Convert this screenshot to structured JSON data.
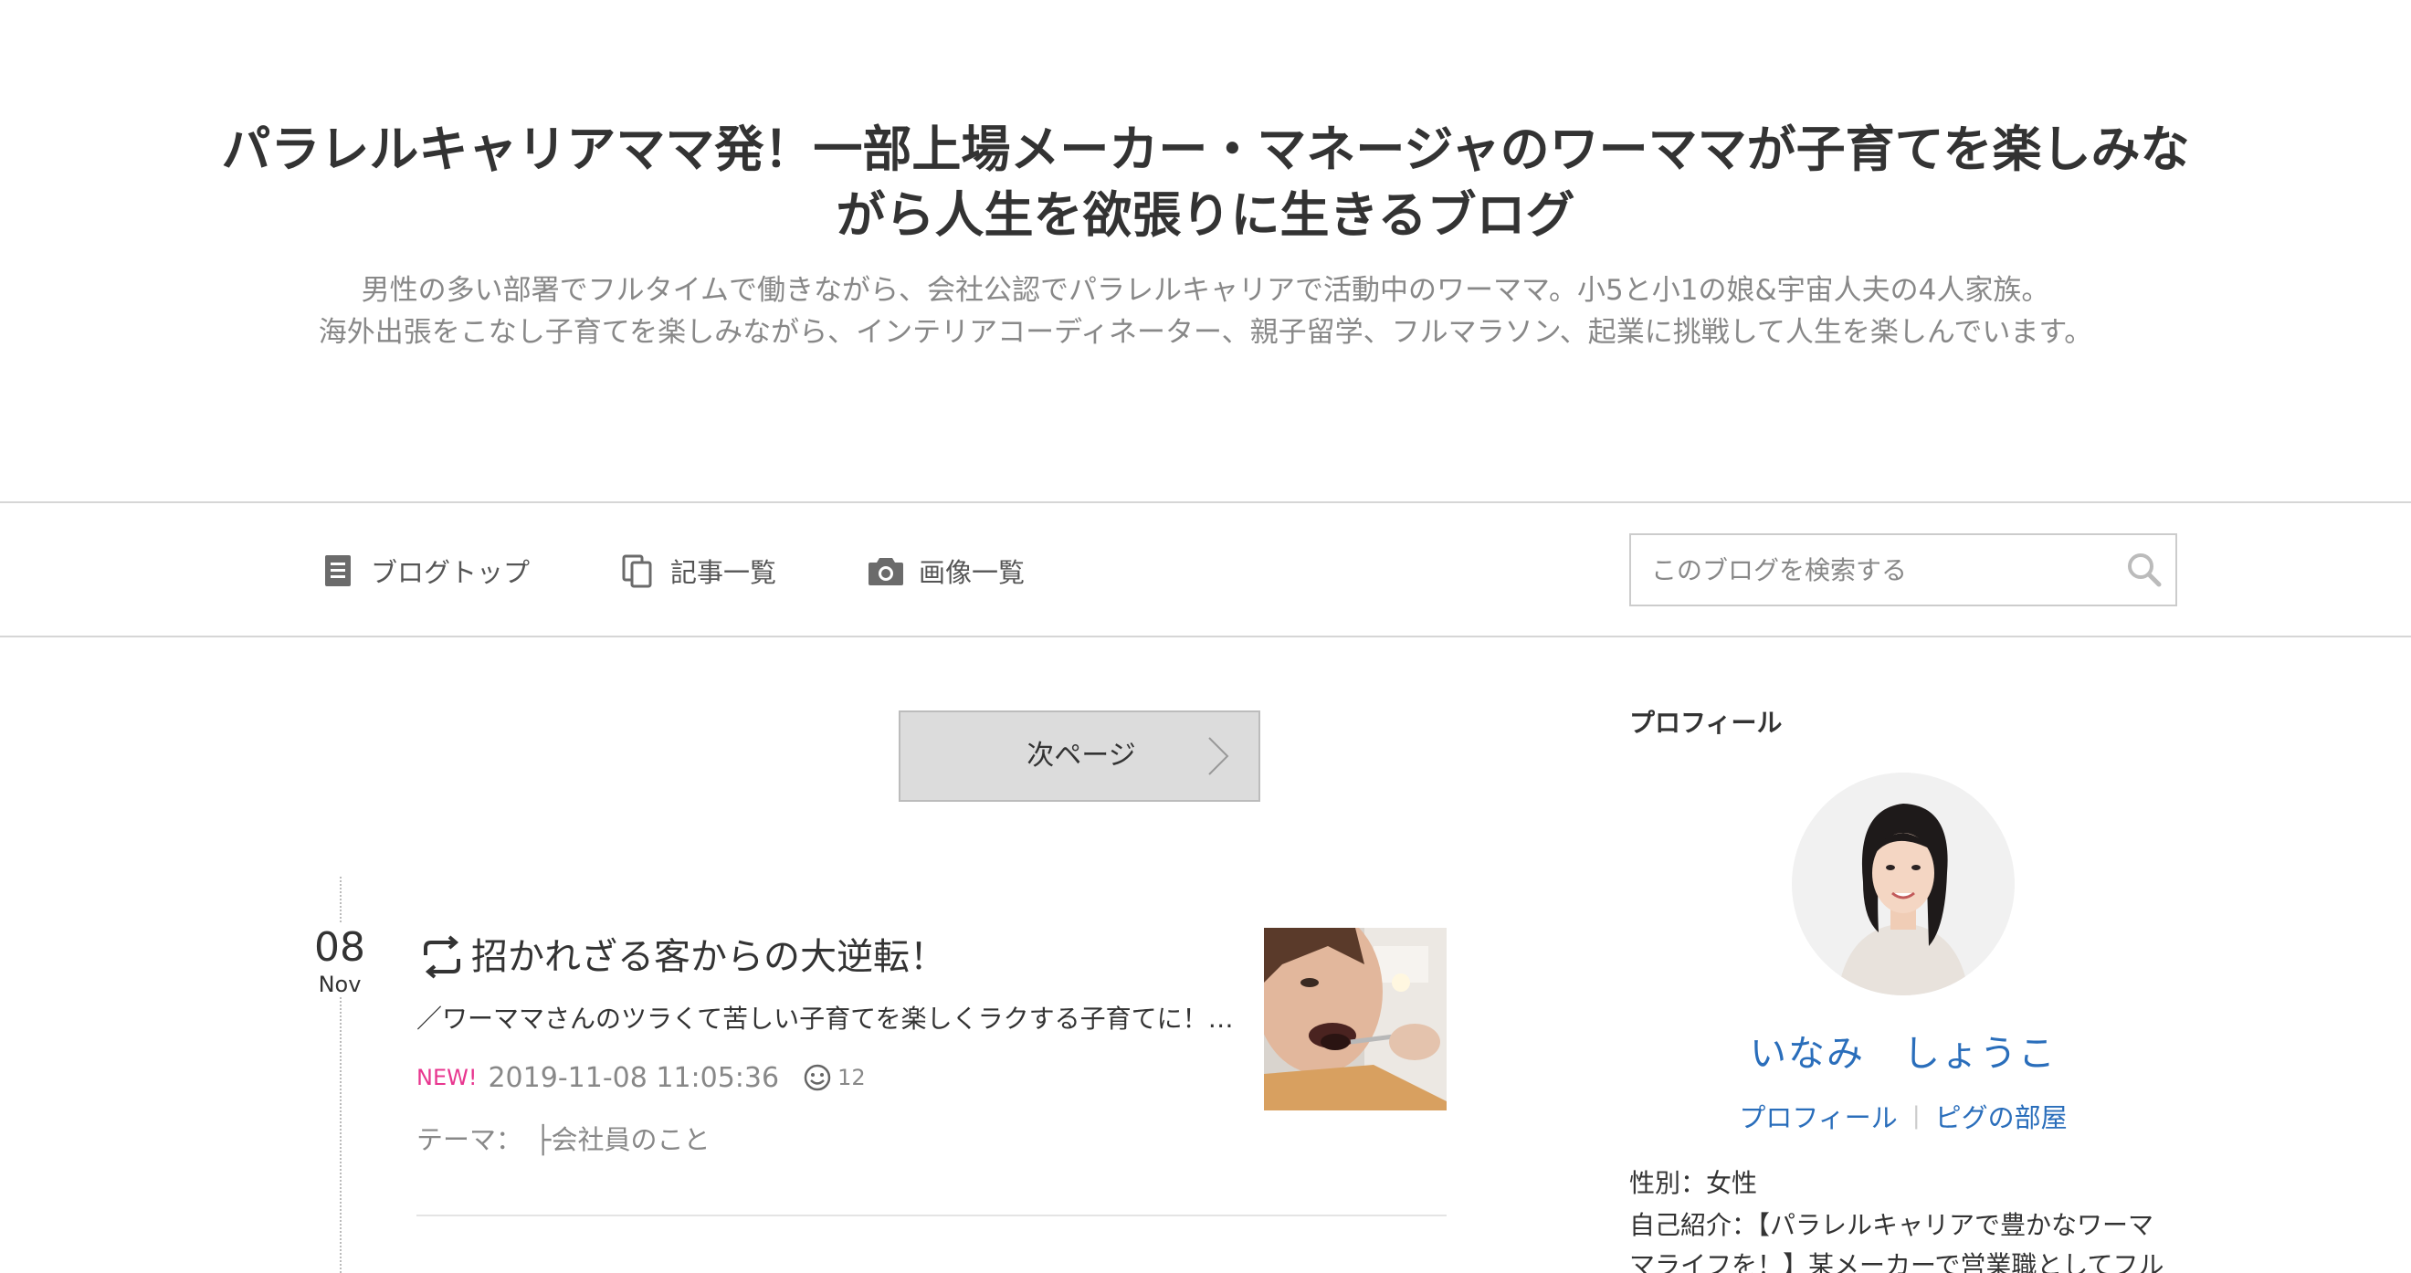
{
  "header": {
    "title": "パラレルキャリアママ発！一部上場メーカー・マネージャのワーママが子育てを楽しみながら人生を欲張りに生きるブログ",
    "description_line1": "男性の多い部署でフルタイムで働きながら、会社公認でパラレルキャリアで活動中のワーママ。小5と小1の娘&宇宙人夫の4人家族。",
    "description_line2": "海外出張をこなし子育てを楽しみながら、インテリアコーディネーター、親子留学、フルマラソン、起業に挑戦して人生を楽しんでいます。"
  },
  "nav": {
    "blog_top": "ブログトップ",
    "entry_list": "記事一覧",
    "image_list": "画像一覧",
    "search_placeholder": "このブログを検索する"
  },
  "pager": {
    "next_label": "次ページ"
  },
  "post": {
    "day": "08",
    "month": "Nov",
    "title": "招かれざる客からの大逆転！",
    "excerpt": "／ワーママさんのツラくて苦しい子育てを楽しくラクする子育てに！…",
    "new_badge": "NEW!",
    "datetime": "2019-11-08 11:05:36",
    "like_count": "12",
    "theme_label": "テーマ：",
    "theme": "├会社員のこと"
  },
  "sidebar": {
    "heading": "プロフィール",
    "name": "いなみ　しょうこ",
    "profile_link": "プロフィール",
    "pig_room_link": "ピグの部屋",
    "gender": "性別：女性",
    "intro": "自己紹介：【パラレルキャリアで豊かなワーママライフを！】某メーカーで営業職としてフル"
  },
  "colors": {
    "link_blue": "#2a6ebb",
    "new_pink": "#e8368f",
    "muted_gray": "#888888",
    "button_gray": "#dcdcdc"
  },
  "icons": {
    "blog_top": "document-icon",
    "entry_list": "copy-icon",
    "image_list": "camera-icon",
    "search": "search-icon",
    "next": "chevron-right-icon",
    "reblog": "reblog-icon",
    "like": "smile-icon"
  }
}
